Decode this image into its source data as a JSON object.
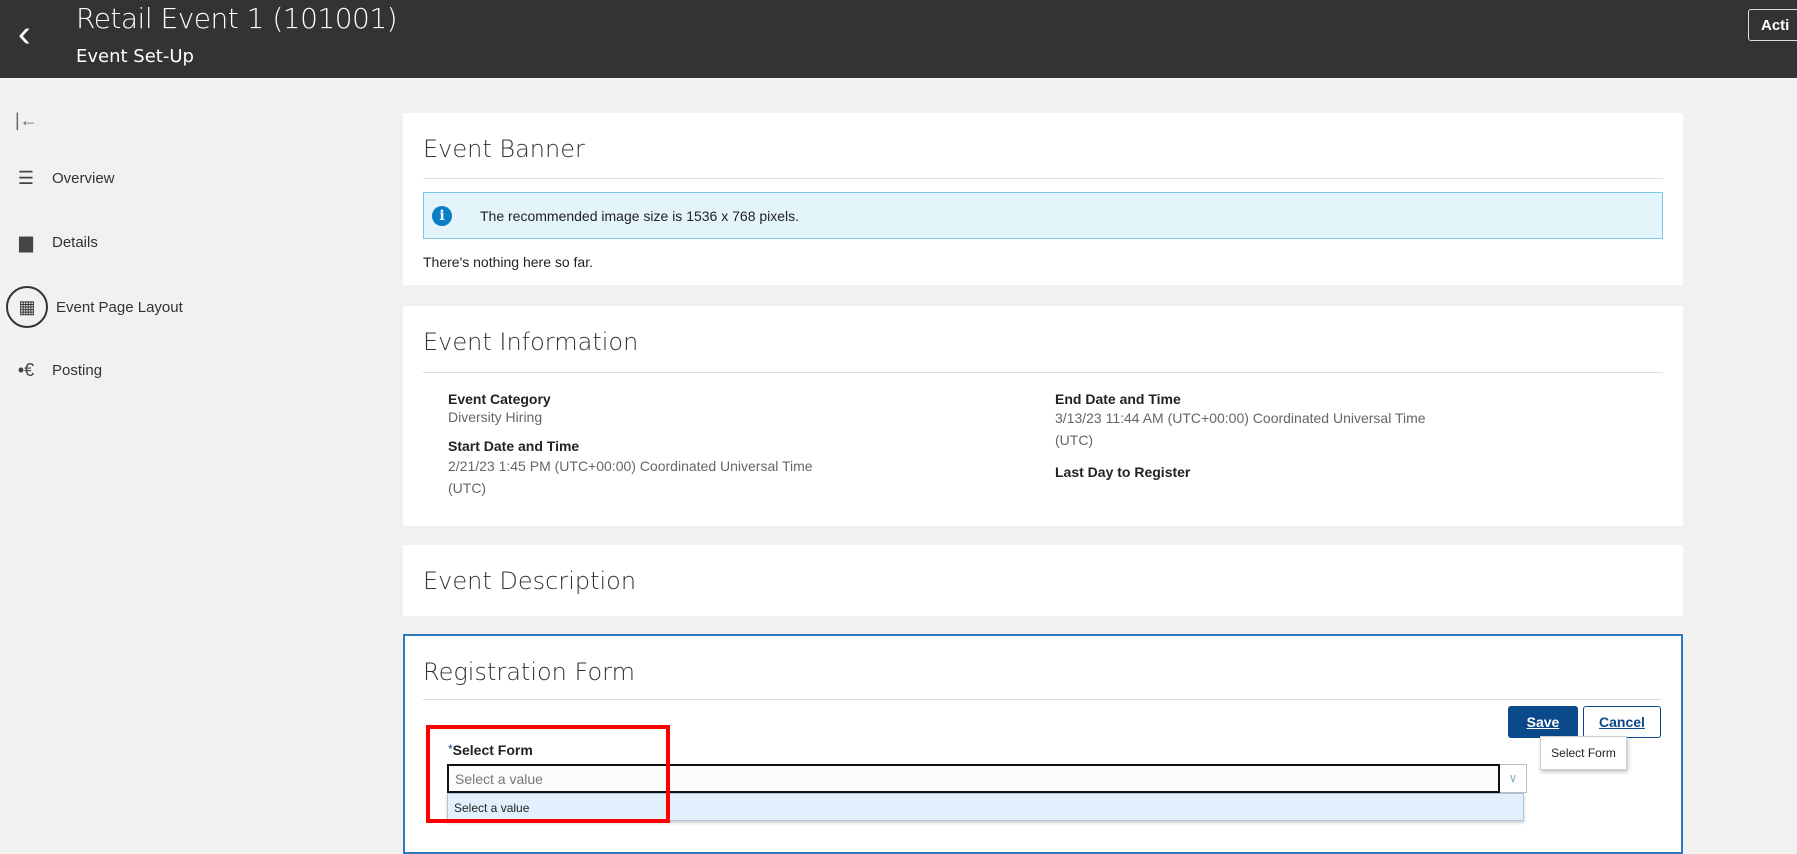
{
  "header": {
    "title": "Retail Event 1 (101001)",
    "subtitle": "Event Set-Up",
    "action_label": "Acti"
  },
  "sidebar": {
    "items": [
      {
        "label": "Overview"
      },
      {
        "label": "Details"
      },
      {
        "label": "Event Page Layout"
      },
      {
        "label": "Posting"
      }
    ]
  },
  "banner": {
    "title": "Event Banner",
    "info": "The recommended image size is 1536 x 768 pixels.",
    "empty": "There's nothing here so far."
  },
  "information": {
    "title": "Event Information",
    "category_label": "Event Category",
    "category": "Diversity Hiring",
    "start_label": "Start Date and Time",
    "start": "2/21/23 1:45 PM (UTC+00:00) Coordinated Universal Time (UTC)",
    "end_label": "End Date and Time",
    "end": "3/13/23 11:44 AM (UTC+00:00) Coordinated Universal Time (UTC)",
    "last_day_label": "Last Day to Register"
  },
  "description": {
    "title": "Event Description"
  },
  "registration": {
    "title": "Registration Form",
    "save": "Save",
    "cancel": "Cancel",
    "required": "*",
    "field_label": "Select Form",
    "placeholder": "Select a value",
    "tooltip": "Select Form",
    "options": [
      "Select a value"
    ]
  },
  "colors": {
    "header": "#333333",
    "accent": "#0a4a8a",
    "highlight": "#ff0000"
  }
}
